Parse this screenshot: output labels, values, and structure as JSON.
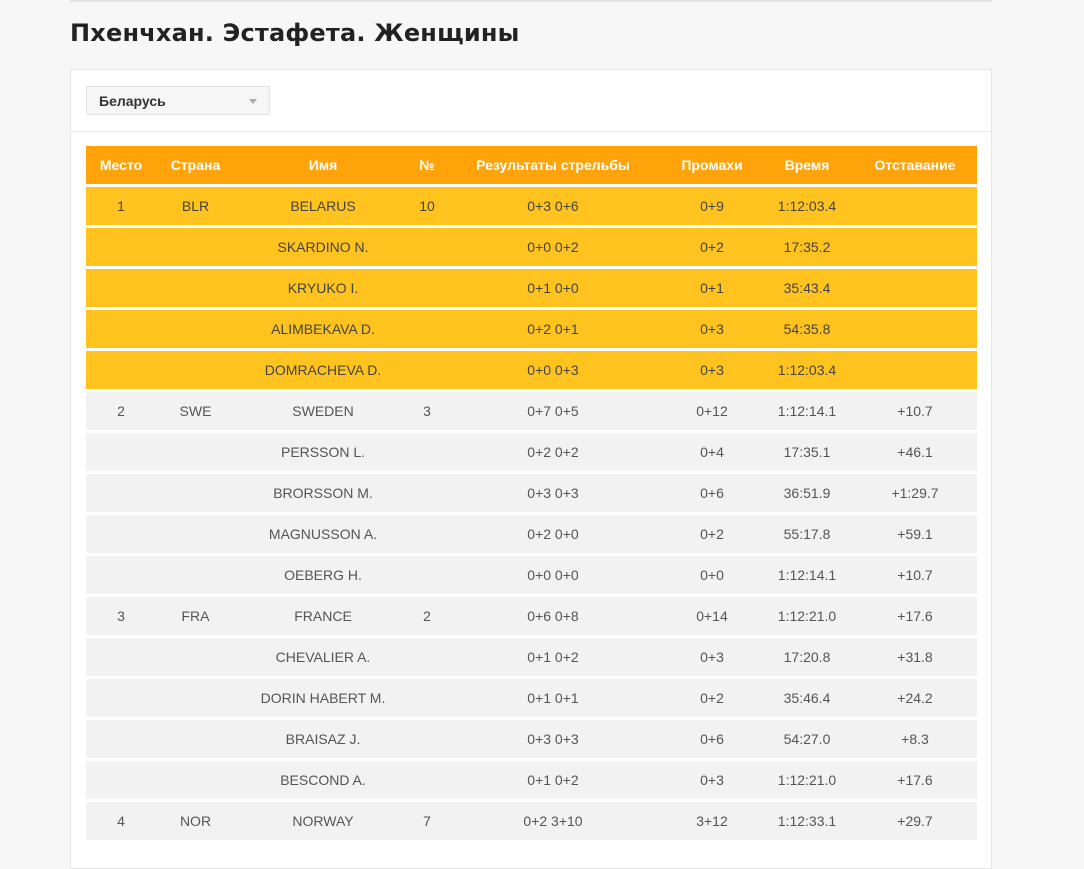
{
  "page": {
    "title": "Пхенчхан. Эстафета. Женщины"
  },
  "filter": {
    "country_value": "Беларусь",
    "icon": "chevron-down-icon"
  },
  "colors": {
    "header_bg": "#ffa30a",
    "highlight_row": "#ffc31f",
    "normal_row": "#f2f2f2"
  },
  "table": {
    "columns": [
      "Место",
      "Страна",
      "Имя",
      "№",
      "Результаты стрельбы",
      "Промахи",
      "Время",
      "Отставание"
    ],
    "rows": [
      {
        "highlight": true,
        "place": "1",
        "country": "BLR",
        "name": "BELARUS",
        "num": "10",
        "shooting": "0+3 0+6",
        "misses": "0+9",
        "time": "1:12:03.4",
        "behind": ""
      },
      {
        "highlight": true,
        "place": "",
        "country": "",
        "name": "SKARDINO N.",
        "num": "",
        "shooting": "0+0 0+2",
        "misses": "0+2",
        "time": "17:35.2",
        "behind": ""
      },
      {
        "highlight": true,
        "place": "",
        "country": "",
        "name": "KRYUKO I.",
        "num": "",
        "shooting": "0+1 0+0",
        "misses": "0+1",
        "time": "35:43.4",
        "behind": ""
      },
      {
        "highlight": true,
        "place": "",
        "country": "",
        "name": "ALIMBEKAVA D.",
        "num": "",
        "shooting": "0+2 0+1",
        "misses": "0+3",
        "time": "54:35.8",
        "behind": ""
      },
      {
        "highlight": true,
        "place": "",
        "country": "",
        "name": "DOMRACHEVA D.",
        "num": "",
        "shooting": "0+0 0+3",
        "misses": "0+3",
        "time": "1:12:03.4",
        "behind": ""
      },
      {
        "highlight": false,
        "place": "2",
        "country": "SWE",
        "name": "SWEDEN",
        "num": "3",
        "shooting": "0+7 0+5",
        "misses": "0+12",
        "time": "1:12:14.1",
        "behind": "+10.7"
      },
      {
        "highlight": false,
        "place": "",
        "country": "",
        "name": "PERSSON L.",
        "num": "",
        "shooting": "0+2 0+2",
        "misses": "0+4",
        "time": "17:35.1",
        "behind": "+46.1"
      },
      {
        "highlight": false,
        "place": "",
        "country": "",
        "name": "BRORSSON M.",
        "num": "",
        "shooting": "0+3 0+3",
        "misses": "0+6",
        "time": "36:51.9",
        "behind": "+1:29.7"
      },
      {
        "highlight": false,
        "place": "",
        "country": "",
        "name": "MAGNUSSON A.",
        "num": "",
        "shooting": "0+2 0+0",
        "misses": "0+2",
        "time": "55:17.8",
        "behind": "+59.1"
      },
      {
        "highlight": false,
        "place": "",
        "country": "",
        "name": "OEBERG H.",
        "num": "",
        "shooting": "0+0 0+0",
        "misses": "0+0",
        "time": "1:12:14.1",
        "behind": "+10.7"
      },
      {
        "highlight": false,
        "place": "3",
        "country": "FRA",
        "name": "FRANCE",
        "num": "2",
        "shooting": "0+6 0+8",
        "misses": "0+14",
        "time": "1:12:21.0",
        "behind": "+17.6"
      },
      {
        "highlight": false,
        "place": "",
        "country": "",
        "name": "CHEVALIER A.",
        "num": "",
        "shooting": "0+1 0+2",
        "misses": "0+3",
        "time": "17:20.8",
        "behind": "+31.8"
      },
      {
        "highlight": false,
        "place": "",
        "country": "",
        "name": "DORIN HABERT M.",
        "num": "",
        "shooting": "0+1 0+1",
        "misses": "0+2",
        "time": "35:46.4",
        "behind": "+24.2"
      },
      {
        "highlight": false,
        "place": "",
        "country": "",
        "name": "BRAISAZ J.",
        "num": "",
        "shooting": "0+3 0+3",
        "misses": "0+6",
        "time": "54:27.0",
        "behind": "+8.3"
      },
      {
        "highlight": false,
        "place": "",
        "country": "",
        "name": "BESCOND A.",
        "num": "",
        "shooting": "0+1 0+2",
        "misses": "0+3",
        "time": "1:12:21.0",
        "behind": "+17.6"
      },
      {
        "highlight": false,
        "place": "4",
        "country": "NOR",
        "name": "NORWAY",
        "num": "7",
        "shooting": "0+2 3+10",
        "misses": "3+12",
        "time": "1:12:33.1",
        "behind": "+29.7"
      }
    ]
  }
}
